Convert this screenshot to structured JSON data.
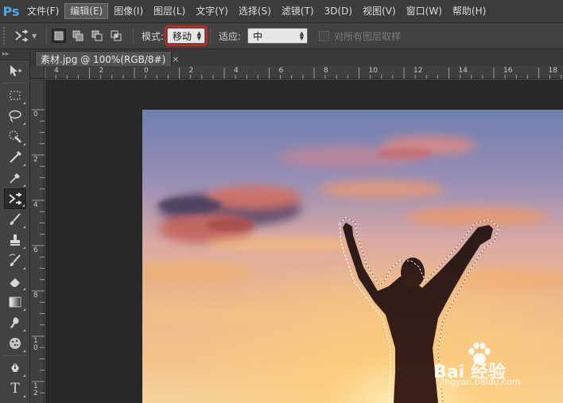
{
  "app": {
    "logo": "Ps"
  },
  "menu": [
    {
      "label": "文件(F)",
      "active": false
    },
    {
      "label": "编辑(E)",
      "active": true
    },
    {
      "label": "图像(I)",
      "active": false
    },
    {
      "label": "图层(L)",
      "active": false
    },
    {
      "label": "文字(Y)",
      "active": false
    },
    {
      "label": "选择(S)",
      "active": false
    },
    {
      "label": "滤镜(T)",
      "active": false
    },
    {
      "label": "3D(D)",
      "active": false
    },
    {
      "label": "视图(V)",
      "active": false
    },
    {
      "label": "窗口(W)",
      "active": false
    },
    {
      "label": "帮助(H)",
      "active": false
    }
  ],
  "options": {
    "mode_label": "模式:",
    "mode_value": "移动",
    "adapt_label": "适应:",
    "adapt_value": "中",
    "sample_all_label": "对所有图层取样"
  },
  "document": {
    "tab_title": "素材.jpg @ 100%(RGB/8#)",
    "close_glyph": "×"
  },
  "rulers": {
    "h_labels": [
      "4",
      "2",
      "0",
      "2",
      "4",
      "6",
      "8",
      "10",
      "12",
      "14",
      "16",
      "18"
    ],
    "v_labels": [
      "0",
      "2",
      "4",
      "6",
      "8",
      "10",
      "12"
    ]
  },
  "watermark": {
    "main": "Bai 经验",
    "sub": "jingyan.baidu.com"
  },
  "colors": {
    "accent": "#4aa9e8",
    "highlight_outline": "#e02020"
  }
}
